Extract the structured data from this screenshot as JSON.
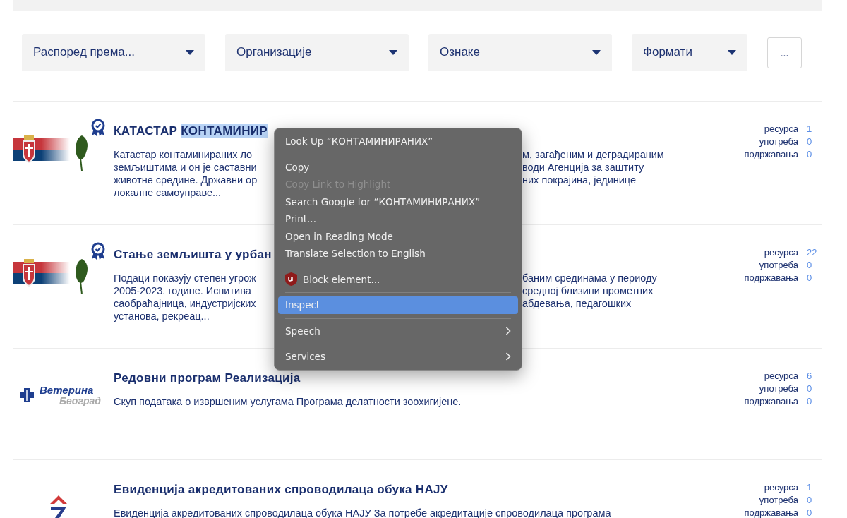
{
  "filters": [
    {
      "label": "Распоред према..."
    },
    {
      "label": "Организације"
    },
    {
      "label": "Ознаке"
    },
    {
      "label": "Формати"
    }
  ],
  "more_button": "...",
  "datasets": [
    {
      "logo": {
        "kind": "flag"
      },
      "awarded": true,
      "title": [
        {
          "text": "КАТАСТАР ",
          "selected": false
        },
        {
          "text": "КОНТАМИНИР",
          "selected": true
        }
      ],
      "description_lines": [
        {
          "left": "Катастар контаминираних ло",
          "right": "м, загађеним и деградираним"
        },
        {
          "left": "земљиштима и он је саставни",
          "right": "води Агенција за заштиту"
        },
        {
          "left": "животне средине. Државни ор",
          "right": "них покрајина, јединице"
        },
        {
          "left": "локалне самоуправе..."
        }
      ],
      "stats": [
        {
          "label": "ресурса",
          "value": "1"
        },
        {
          "label": "употреба",
          "value": "0"
        },
        {
          "label": "подржавања",
          "value": "0"
        }
      ]
    },
    {
      "logo": {
        "kind": "flag"
      },
      "awarded": true,
      "title": [
        {
          "text": "Стање земљишта у урбан",
          "selected": false
        }
      ],
      "description_lines": [
        {
          "left": "Подаци показују степен угрож",
          "right": "баним срединама у периоду"
        },
        {
          "left": "2005-2023. године. Испитива",
          "right": "средној близини прометних"
        },
        {
          "left": "саобраћајница, индустријских",
          "right": "абдевања, педагошких"
        },
        {
          "left": "установа, рекреац..."
        }
      ],
      "stats": [
        {
          "label": "ресурса",
          "value": "22"
        },
        {
          "label": "употреба",
          "value": "0"
        },
        {
          "label": "подржавања",
          "value": "0"
        }
      ]
    },
    {
      "logo": {
        "kind": "veterina",
        "text": [
          "Ветерина",
          "Београд"
        ]
      },
      "awarded": false,
      "title": [
        {
          "text": "Редовни програм Реализација",
          "selected": false
        }
      ],
      "description_lines": [
        {
          "left": "Скуп података о извршеним услугама Програма делатности зоохигијене."
        }
      ],
      "stats": [
        {
          "label": "ресурса",
          "value": "6"
        },
        {
          "label": "употреба",
          "value": "0"
        },
        {
          "label": "подржавања",
          "value": "0"
        }
      ]
    },
    {
      "logo": {
        "kind": "chevron"
      },
      "awarded": false,
      "title": [
        {
          "text": "Евиденција акредитованих спроводилаца обука НАЈУ",
          "selected": false
        }
      ],
      "description_lines": [
        {
          "left": "Евиденција акредитованих спроводилаца обука НАЈУ За потребе акредитације спроводилаца програма"
        }
      ],
      "stats": [
        {
          "label": "ресурса",
          "value": "1"
        },
        {
          "label": "употреба",
          "value": "0"
        },
        {
          "label": "подржавања",
          "value": "0"
        }
      ]
    }
  ],
  "context_menu": [
    {
      "kind": "item",
      "label": "Look Up “КОНТАМИНИРАНИХ”",
      "disabled": false,
      "selected": false
    },
    {
      "kind": "separator"
    },
    {
      "kind": "item",
      "label": "Copy",
      "disabled": false,
      "selected": false
    },
    {
      "kind": "item",
      "label": "Copy Link to Highlight",
      "disabled": true,
      "selected": false
    },
    {
      "kind": "item",
      "label": "Search Google for “КОНТАМИНИРАНИХ”",
      "disabled": false,
      "selected": false
    },
    {
      "kind": "item",
      "label": "Print...",
      "disabled": false,
      "selected": false
    },
    {
      "kind": "item",
      "label": "Open in Reading Mode",
      "disabled": false,
      "selected": false
    },
    {
      "kind": "item",
      "label": "Translate Selection to English",
      "disabled": false,
      "selected": false
    },
    {
      "kind": "separator"
    },
    {
      "kind": "extension",
      "label": "Block element...",
      "disabled": false,
      "selected": false
    },
    {
      "kind": "separator"
    },
    {
      "kind": "item",
      "label": "Inspect",
      "disabled": false,
      "selected": true
    },
    {
      "kind": "separator"
    },
    {
      "kind": "submenu",
      "label": "Speech",
      "disabled": false,
      "selected": false
    },
    {
      "kind": "separator"
    },
    {
      "kind": "submenu",
      "label": "Services",
      "disabled": false,
      "selected": false
    }
  ]
}
